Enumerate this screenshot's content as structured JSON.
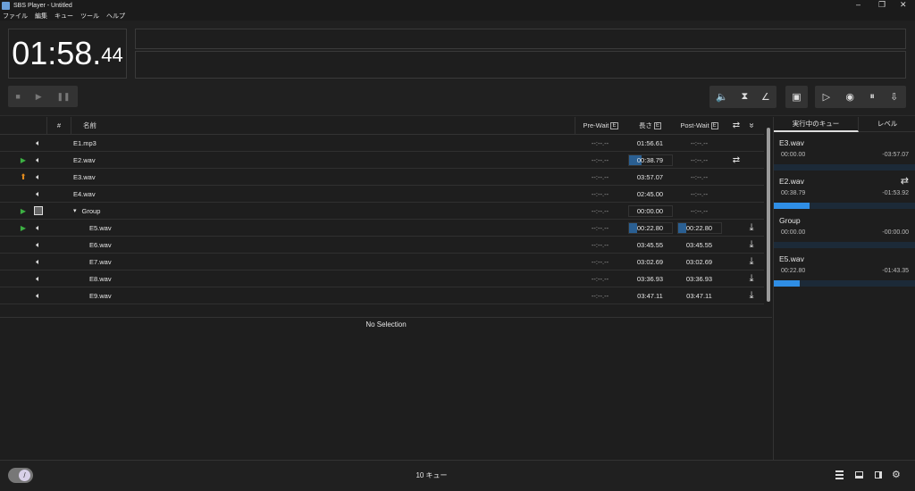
{
  "window": {
    "title": "SBS Player - Untitled",
    "minimize": "–",
    "maximize": "❐",
    "close": "✕"
  },
  "menu": [
    "ファイル",
    "編集",
    "キュー",
    "ツール",
    "ヘルプ"
  ],
  "clock": {
    "main": "01:58.",
    "fraction": "44"
  },
  "transport": {
    "stop": "■",
    "play": "▶",
    "pause": "❚❚"
  },
  "toolbar": {
    "volume": "🔈",
    "hourglass": "⧗",
    "curve": "∠",
    "group": "▣",
    "go": "▷",
    "stop_all": "◉",
    "pause_all": "⏸",
    "fade": "⇩"
  },
  "table": {
    "headers": {
      "num": "#",
      "name": "名前",
      "prewait": "Pre-Wait",
      "length": "長さ",
      "postwait": "Post-Wait",
      "e": "E",
      "loop": "⇄",
      "more": "»"
    },
    "rows": [
      {
        "status": "",
        "type": "speaker",
        "name": "E1.mp3",
        "indent": 0,
        "prewait": "--:--.--",
        "length": "01:56.61",
        "postwait": "--:--.--",
        "loop": "",
        "end": "",
        "len_progress": 0,
        "post_progress": null
      },
      {
        "status": "play",
        "type": "speaker",
        "name": "E2.wav",
        "indent": 0,
        "prewait": "--:--.--",
        "length": "00:38.79",
        "postwait": "--:--.--",
        "loop": "⇄",
        "end": "",
        "len_progress": 0.3,
        "post_progress": null
      },
      {
        "status": "fade",
        "type": "speaker",
        "name": "E3.wav",
        "indent": 0,
        "prewait": "--:--.--",
        "length": "03:57.07",
        "postwait": "--:--.--",
        "loop": "",
        "end": "",
        "len_progress": 0,
        "post_progress": null
      },
      {
        "status": "",
        "type": "speaker",
        "name": "E4.wav",
        "indent": 0,
        "prewait": "--:--.--",
        "length": "02:45.00",
        "postwait": "--:--.--",
        "loop": "",
        "end": "",
        "len_progress": 0,
        "post_progress": null
      },
      {
        "status": "play",
        "type": "group",
        "name": "Group",
        "indent": 0,
        "prewait": "--:--.--",
        "length": "00:00.00",
        "postwait": "--:--.--",
        "loop": "",
        "end": "",
        "len_progress": 0,
        "post_progress": null,
        "expander": "▾"
      },
      {
        "status": "play",
        "type": "speaker",
        "name": "E5.wav",
        "indent": 1,
        "prewait": "--:--.--",
        "length": "00:22.80",
        "postwait": "00:22.80",
        "loop": "",
        "end": "⤓",
        "len_progress": 0.2,
        "post_progress": 0.2
      },
      {
        "status": "",
        "type": "speaker",
        "name": "E6.wav",
        "indent": 1,
        "prewait": "--:--.--",
        "length": "03:45.55",
        "postwait": "03:45.55",
        "loop": "",
        "end": "⤓",
        "len_progress": 0,
        "post_progress": null
      },
      {
        "status": "",
        "type": "speaker",
        "name": "E7.wav",
        "indent": 1,
        "prewait": "--:--.--",
        "length": "03:02.69",
        "postwait": "03:02.69",
        "loop": "",
        "end": "⤓",
        "len_progress": 0,
        "post_progress": null
      },
      {
        "status": "",
        "type": "speaker",
        "name": "E8.wav",
        "indent": 1,
        "prewait": "--:--.--",
        "length": "03:36.93",
        "postwait": "03:36.93",
        "loop": "",
        "end": "⤓",
        "len_progress": 0,
        "post_progress": null
      },
      {
        "status": "",
        "type": "speaker",
        "name": "E9.wav",
        "indent": 1,
        "prewait": "--:--.--",
        "length": "03:47.11",
        "postwait": "03:47.11",
        "loop": "",
        "end": "⤓",
        "len_progress": 0,
        "post_progress": null
      }
    ]
  },
  "inspector": {
    "empty": "No Selection"
  },
  "right_panel": {
    "tabs": [
      "実行中のキュー",
      "レベル"
    ],
    "active": [
      {
        "name": "E3.wav",
        "elapsed": "00:00.00",
        "remaining": "-03:57.07",
        "progress": 0,
        "loop": ""
      },
      {
        "name": "E2.wav",
        "elapsed": "00:38.79",
        "remaining": "-01:53.92",
        "progress": 0.25,
        "loop": "⇄"
      },
      {
        "name": "Group",
        "elapsed": "00:00.00",
        "remaining": "-00:00.00",
        "progress": 0,
        "loop": ""
      },
      {
        "name": "E5.wav",
        "elapsed": "00:22.80",
        "remaining": "-01:43.35",
        "progress": 0.18,
        "loop": ""
      }
    ]
  },
  "status": {
    "count": "10 キュー"
  },
  "colors": {
    "accent": "#2f8ee5",
    "play": "#3cb043",
    "fade": "#e08a1e"
  }
}
